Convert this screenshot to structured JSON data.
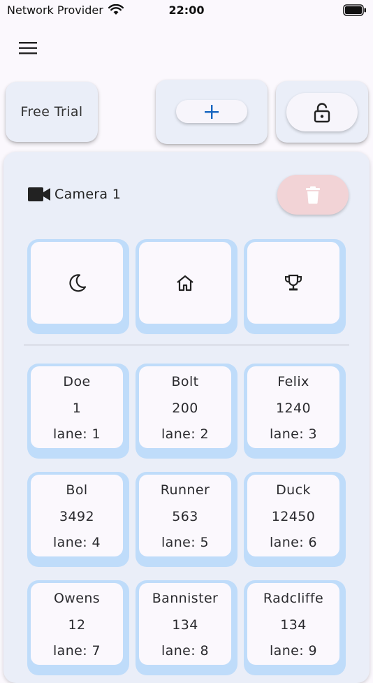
{
  "status_bar": {
    "carrier": "Network Provider",
    "time": "22:00"
  },
  "header": {
    "menu_icon": "hamburger-menu-icon",
    "free_trial_label": "Free Trial",
    "add_icon": "plus-icon",
    "lock_icon": "unlock-icon"
  },
  "camera": {
    "label": "Camera 1",
    "icon": "videocam-icon",
    "delete_icon": "trash-icon"
  },
  "modes": [
    {
      "icon": "moon-icon"
    },
    {
      "icon": "home-icon"
    },
    {
      "icon": "trophy-icon"
    }
  ],
  "racers": [
    {
      "name": "Doe",
      "value": "1",
      "lane": "lane: 1"
    },
    {
      "name": "Bolt",
      "value": "200",
      "lane": "lane: 2"
    },
    {
      "name": "Felix",
      "value": "1240",
      "lane": "lane: 3"
    },
    {
      "name": "Bol",
      "value": "3492",
      "lane": "lane: 4"
    },
    {
      "name": "Runner",
      "value": "563",
      "lane": "lane: 5"
    },
    {
      "name": "Duck",
      "value": "12450",
      "lane": "lane: 6"
    },
    {
      "name": "Owens",
      "value": "12",
      "lane": "lane: 7"
    },
    {
      "name": "Bannister",
      "value": "134",
      "lane": "lane: 8"
    },
    {
      "name": "Radcliffe",
      "value": "134",
      "lane": "lane: 9"
    }
  ],
  "colors": {
    "accent": "#1565c0",
    "tile_border": "#bfdcfa",
    "delete_bg": "#f2d3d6",
    "panel_bg": "#eaeef8"
  }
}
